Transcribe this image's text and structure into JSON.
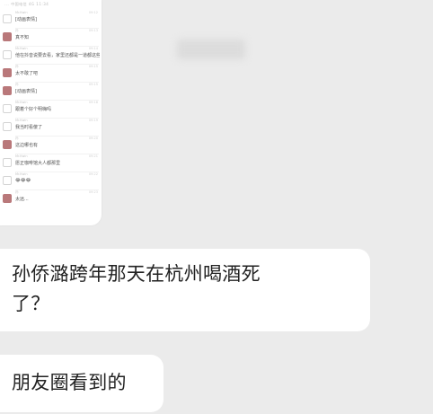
{
  "thumbnail": {
    "status_bar": "... 中国电信 4G 11:34",
    "rows": [
      {
        "avatar": "icon",
        "name": "Mr.Kwin",
        "time": "09:12",
        "text": "[动画表情]"
      },
      {
        "avatar": "friend",
        "name": "孙",
        "time": "09:13",
        "text": "真不知"
      },
      {
        "avatar": "icon",
        "name": "Mr.Kwin",
        "time": "09:14",
        "text": "他在抖音说要去看，家里还都是一道都这些等"
      },
      {
        "avatar": "friend",
        "name": "孙",
        "time": "09:15",
        "text": "太不敢了吧"
      },
      {
        "avatar": "friend",
        "name": "孙",
        "time": "09:15",
        "text": "[动画表情]"
      },
      {
        "avatar": "icon",
        "name": "Mr.Kwin",
        "time": "09:18",
        "text": "跟着个好个明嗨吗"
      },
      {
        "avatar": "icon",
        "name": "Mr.Kwin",
        "time": "09:19",
        "text": "我当时看傻了"
      },
      {
        "avatar": "friend",
        "name": "孙",
        "time": "09:20",
        "text": "这边哪也有"
      },
      {
        "avatar": "icon",
        "name": "Mr.Kwin",
        "time": "09:21",
        "text": "愿正咖啡馆大人都那里"
      },
      {
        "avatar": "icon",
        "name": "Mr.Kwin",
        "time": "09:22",
        "text": "😂😂😂"
      },
      {
        "avatar": "friend",
        "name": "孙",
        "time": "09:23",
        "text": "太远..."
      }
    ]
  },
  "messages": [
    {
      "text": "孙侨潞跨年那天在杭州喝酒死\n了？"
    },
    {
      "text": "朋友圈看到的"
    }
  ]
}
